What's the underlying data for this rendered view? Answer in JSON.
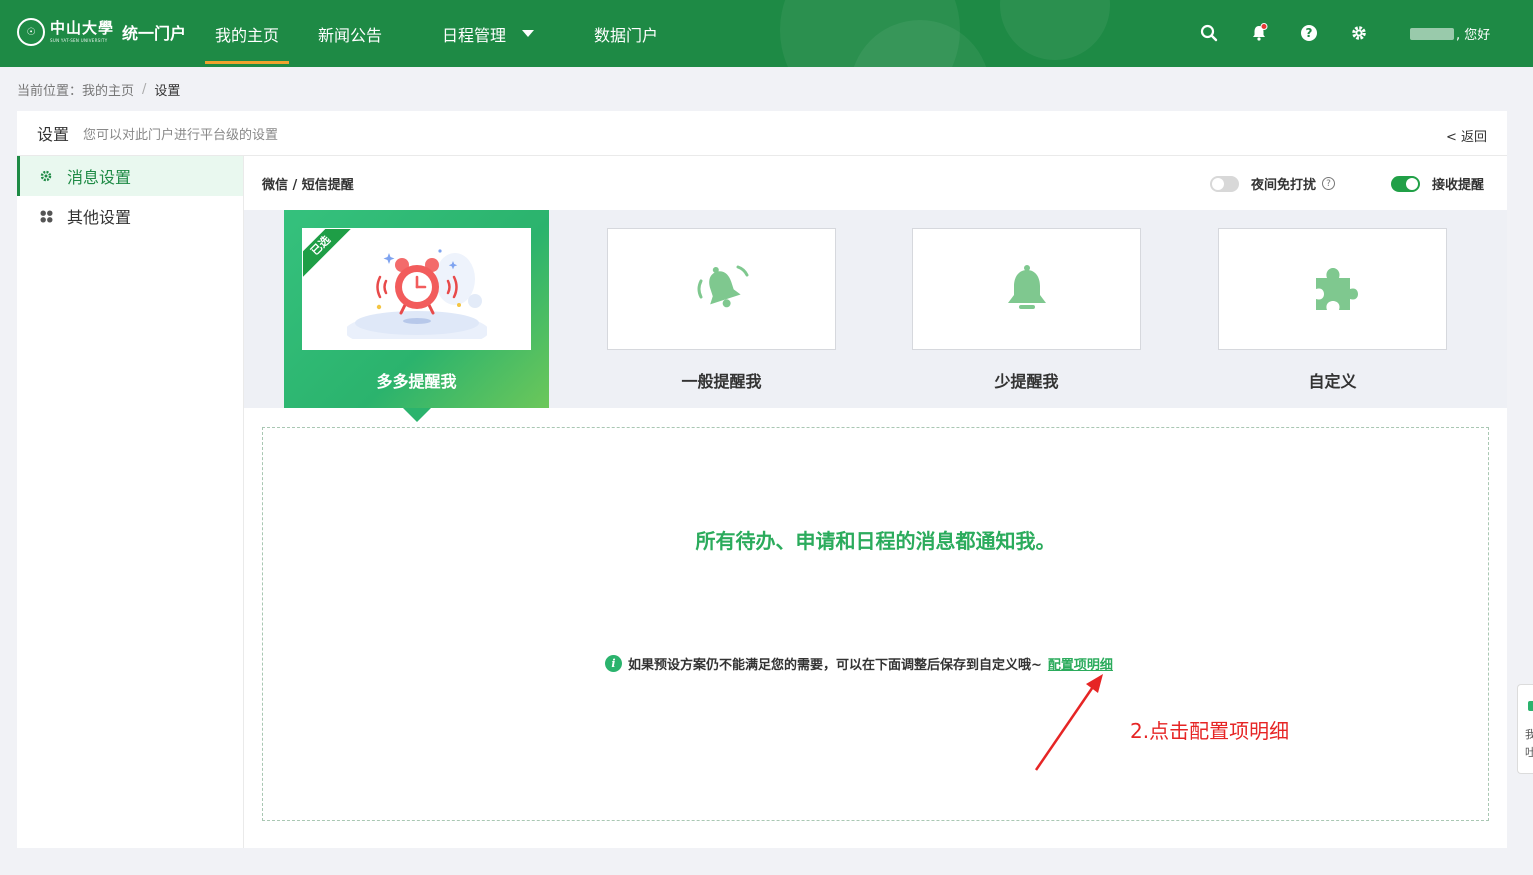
{
  "header": {
    "logo_cn": "中山大學",
    "logo_en": "SUN YAT-SEN UNIVERSITY",
    "app_name": "统一门户",
    "nav": [
      {
        "label": "我的主页",
        "active": true
      },
      {
        "label": "新闻公告",
        "active": false
      },
      {
        "label": "日程管理",
        "active": false,
        "has_dropdown": true
      },
      {
        "label": "数据门户",
        "active": false
      }
    ],
    "icons": [
      "search-icon",
      "bell-icon",
      "help-icon",
      "gear-icon"
    ],
    "greeting": ", 您好"
  },
  "breadcrumb": {
    "prefix": "当前位置：",
    "items": [
      "我的主页",
      "设置"
    ],
    "separator": "/"
  },
  "panel": {
    "title": "设置",
    "description": "您可以对此门户进行平台级的设置",
    "back": "< 返回"
  },
  "sidebar": {
    "items": [
      {
        "label": "消息设置",
        "icon": "gear-icon",
        "active": true
      },
      {
        "label": "其他设置",
        "icon": "grid-icon",
        "active": false
      }
    ]
  },
  "content": {
    "title": "微信 / 短信提醒",
    "night_mode": {
      "label": "夜间免打扰",
      "on": false
    },
    "receive": {
      "label": "接收提醒",
      "on": true
    }
  },
  "modes": [
    {
      "label": "多多提醒我",
      "icon": "alarm-clock-icon",
      "selected": true,
      "badge": "已选"
    },
    {
      "label": "一般提醒我",
      "icon": "ringing-bell-icon",
      "selected": false
    },
    {
      "label": "少提醒我",
      "icon": "bell-icon",
      "selected": false
    },
    {
      "label": "自定义",
      "icon": "puzzle-icon",
      "selected": false
    }
  ],
  "detail": {
    "message": "所有待办、申请和日程的消息都通知我。",
    "hint": "如果预设方案仍不能满足您的需要，可以在下面调整后保存到自定义哦~",
    "link": "配置项明细"
  },
  "annotation": {
    "text": "2.点击配置项明细",
    "color": "#e62525"
  },
  "colors": {
    "primary_green": "#1e8a45",
    "accent_green": "#2bb36d",
    "nav_underline": "#f0a22e"
  }
}
